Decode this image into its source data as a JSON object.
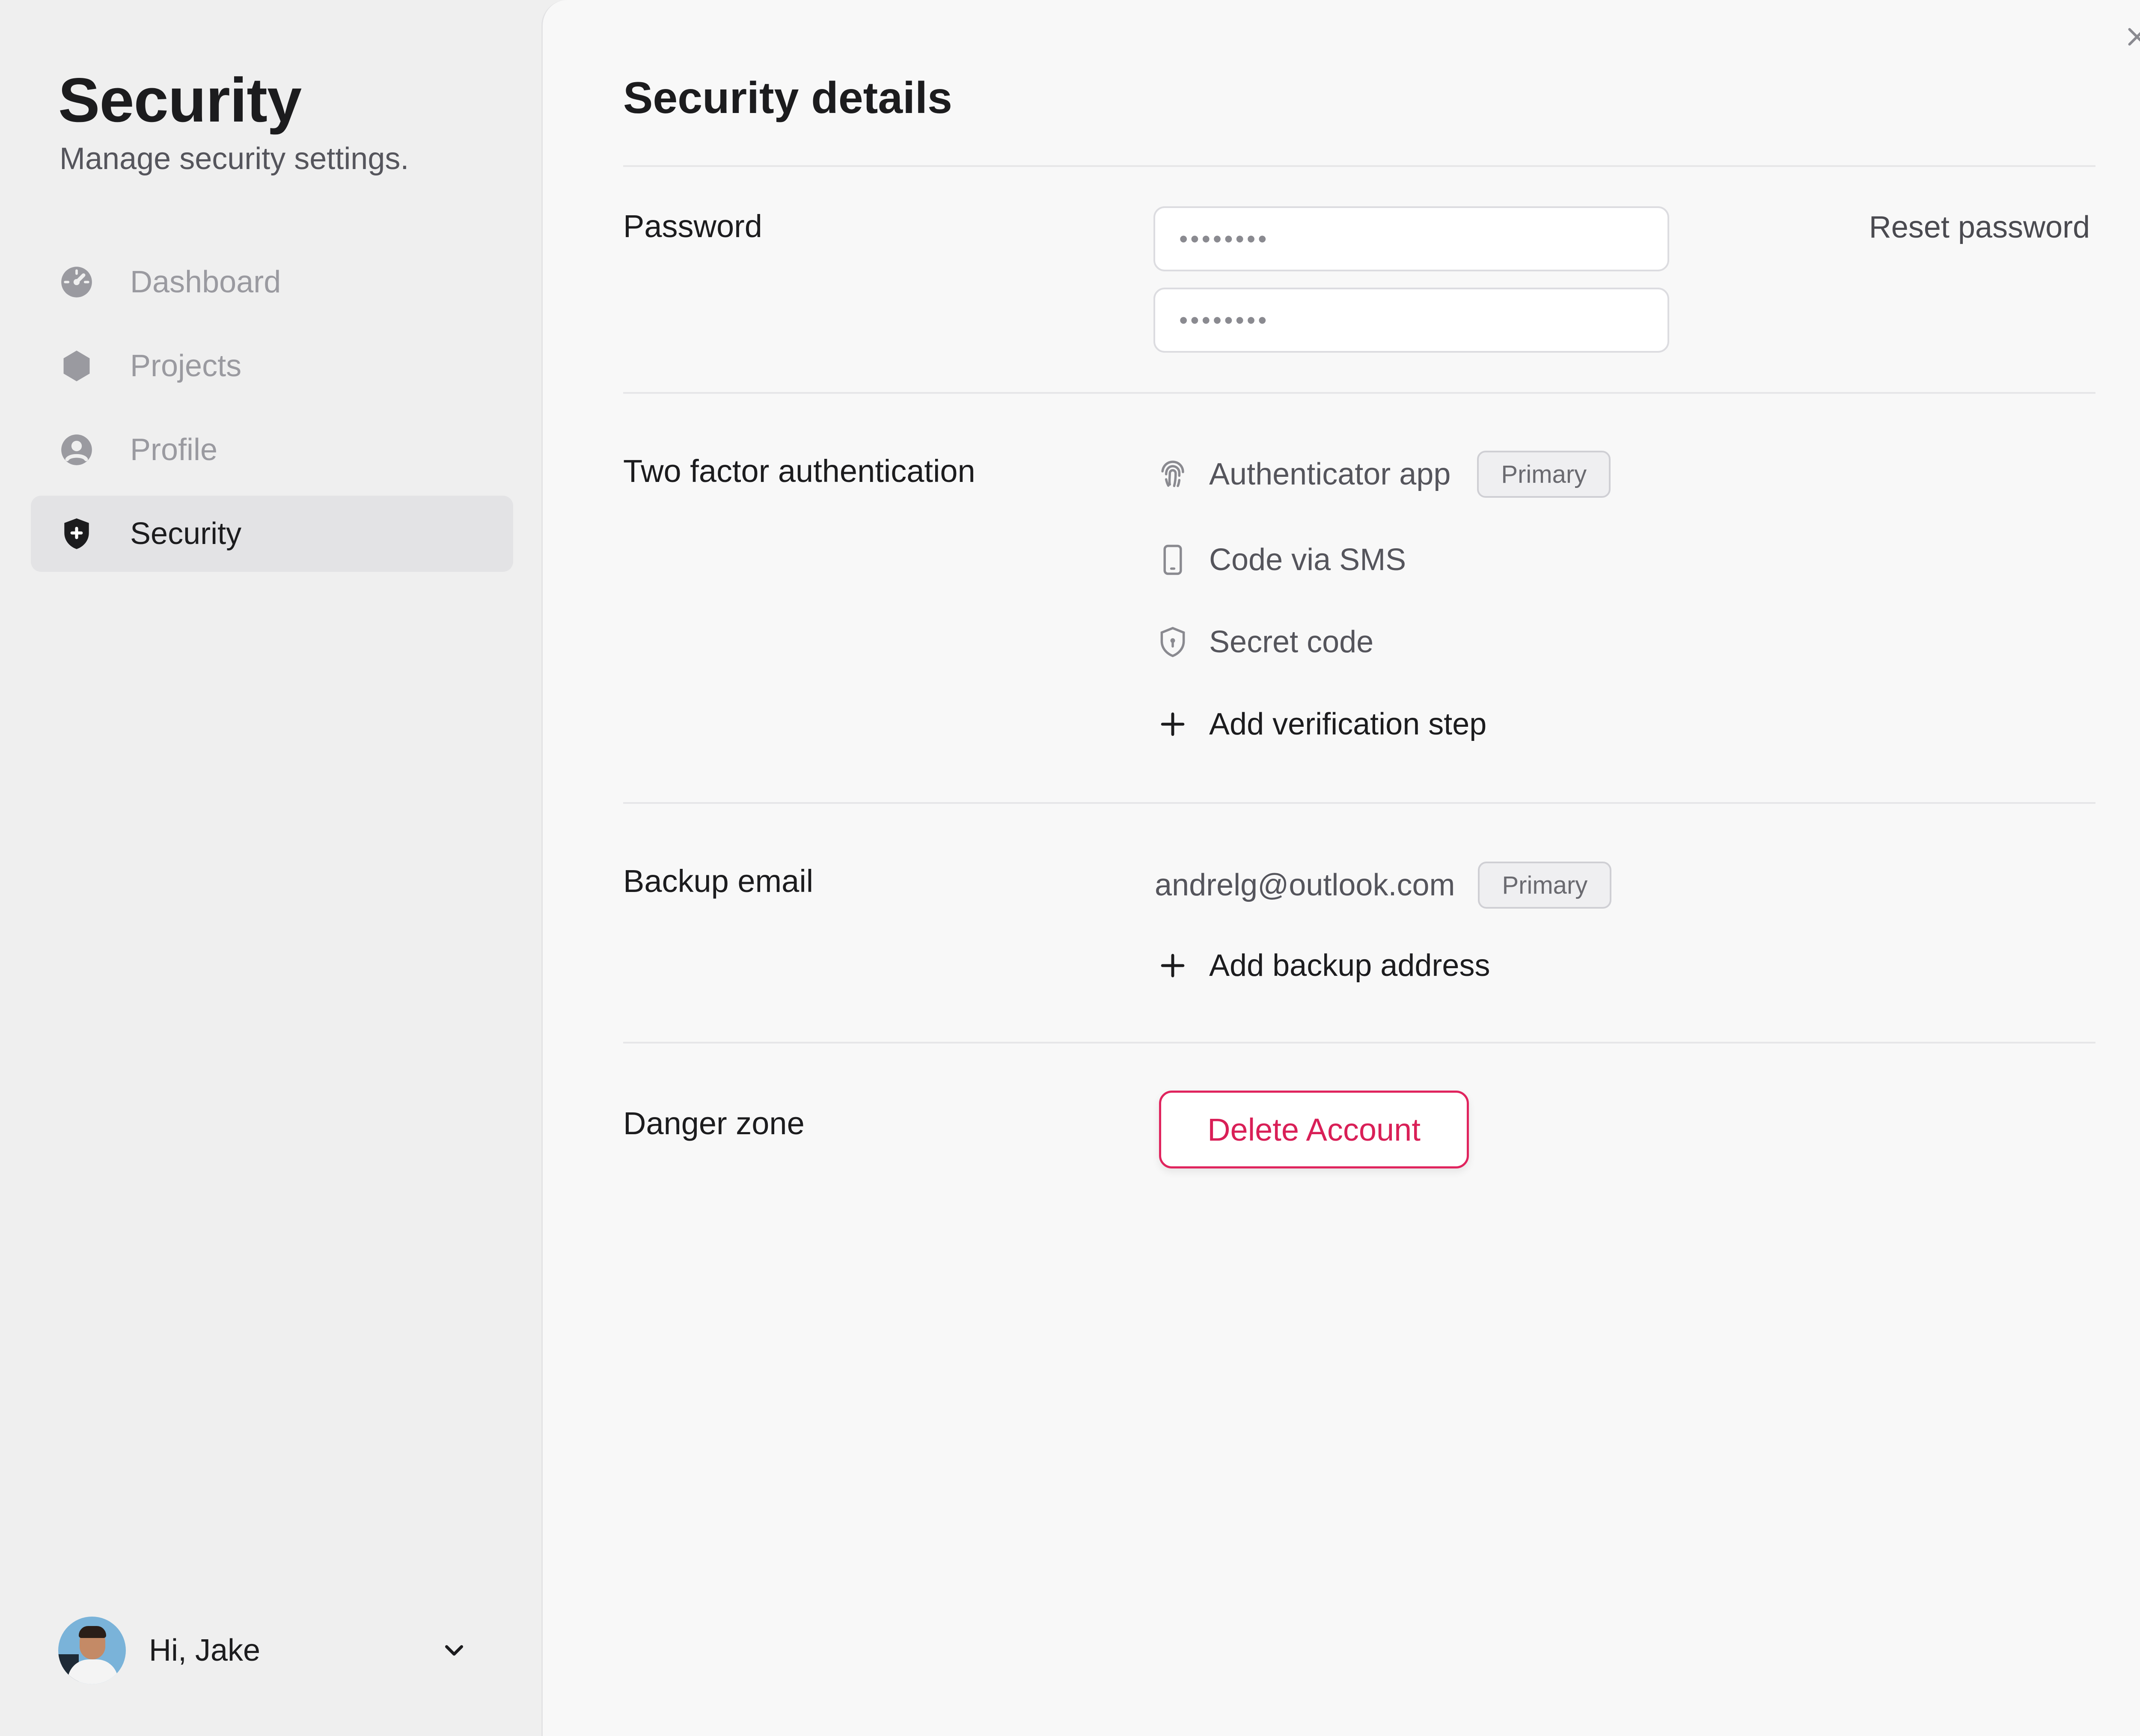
{
  "sidebar": {
    "title": "Security",
    "subtitle": "Manage security settings.",
    "items": [
      {
        "label": "Dashboard",
        "icon": "dashboard-icon",
        "active": false
      },
      {
        "label": "Projects",
        "icon": "hexagon-icon",
        "active": false
      },
      {
        "label": "Profile",
        "icon": "user-circle-icon",
        "active": false
      },
      {
        "label": "Security",
        "icon": "shield-plus-icon",
        "active": true
      }
    ],
    "user": {
      "greeting": "Hi, Jake",
      "icon": "chevron-down-icon"
    }
  },
  "main": {
    "title": "Security details",
    "close_icon": "close-icon",
    "password": {
      "label": "Password",
      "field_1": "••••••••",
      "field_2": "••••••••",
      "reset_label": "Reset password"
    },
    "two_factor": {
      "label": "Two factor authentication",
      "options": [
        {
          "label": "Authenticator app",
          "icon": "fingerprint-icon",
          "badge": "Primary"
        },
        {
          "label": "Code via SMS",
          "icon": "phone-icon"
        },
        {
          "label": "Secret code",
          "icon": "shield-lock-icon"
        }
      ],
      "add_label": "Add verification step"
    },
    "backup_email": {
      "label": "Backup email",
      "email": "andrelg@outlook.com",
      "badge": "Primary",
      "add_label": "Add backup address"
    },
    "danger_zone": {
      "label": "Danger zone",
      "delete_label": "Delete Account"
    }
  },
  "colors": {
    "accent_danger": "#e0245e",
    "sidebar_bg": "#efefef",
    "panel_bg": "#f8f8f8"
  }
}
